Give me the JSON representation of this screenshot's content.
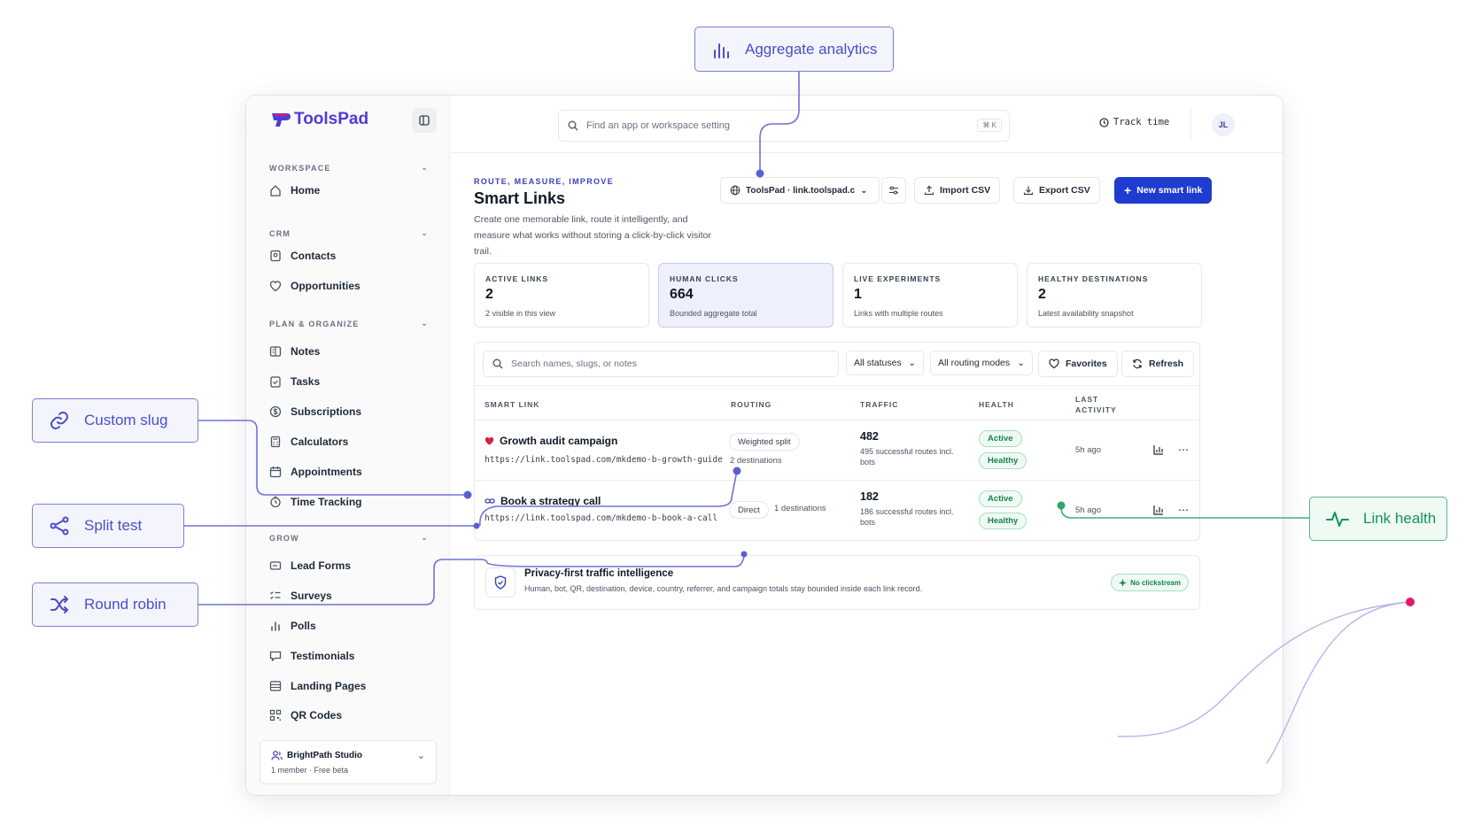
{
  "callouts": {
    "aggregate": "Aggregate analytics",
    "custom_slug": "Custom slug",
    "split_test": "Split test",
    "round_robin": "Round robin",
    "link_health": "Link health"
  },
  "brand": {
    "name": "ToolsPad",
    "accent": "#4f3cd6",
    "primary": "#1f3bd0",
    "healthy_green": "#16935a"
  },
  "sidebar": {
    "sections": [
      {
        "title": "WORKSPACE",
        "items": [
          "Home"
        ]
      },
      {
        "title": "CRM",
        "items": [
          "Contacts",
          "Opportunities"
        ]
      },
      {
        "title": "PLAN & ORGANIZE",
        "items": [
          "Notes",
          "Tasks",
          "Subscriptions",
          "Calculators",
          "Appointments",
          "Time Tracking"
        ]
      },
      {
        "title": "GROW",
        "items": [
          "Lead Forms",
          "Surveys",
          "Polls",
          "Testimonials",
          "Landing Pages",
          "QR Codes"
        ]
      }
    ],
    "workspace": {
      "name": "BrightPath Studio",
      "sub": "1 member · Free beta"
    }
  },
  "topbar": {
    "search_placeholder": "Find an app or workspace setting",
    "shortcut": "⌘ K",
    "track_time": "Track time",
    "avatar_initials": "JL"
  },
  "header": {
    "eyebrow": "ROUTE, MEASURE, IMPROVE",
    "title": "Smart Links",
    "description": "Create one memorable link, route it intelligently, and measure what works without storing a click-by-click visitor trail."
  },
  "actions": {
    "domain_select": "ToolsPad · link.toolspad.c",
    "import": "Import CSV",
    "export": "Export CSV",
    "new": "New smart link"
  },
  "stats": [
    {
      "label": "ACTIVE LINKS",
      "value": "2",
      "note": "2 visible in this view"
    },
    {
      "label": "HUMAN CLICKS",
      "value": "664",
      "note": "Bounded aggregate total"
    },
    {
      "label": "LIVE EXPERIMENTS",
      "value": "1",
      "note": "Links with multiple routes"
    },
    {
      "label": "HEALTHY DESTINATIONS",
      "value": "2",
      "note": "Latest availability snapshot"
    }
  ],
  "filters": {
    "search_placeholder": "Search names, slugs, or notes",
    "status": "All statuses",
    "routing": "All routing modes",
    "favorites": "Favorites",
    "refresh": "Refresh"
  },
  "table": {
    "columns": {
      "link": "SMART LINK",
      "routing": "ROUTING",
      "traffic": "TRAFFIC",
      "health": "HEALTH",
      "last_l1": "LAST",
      "last_l2": "ACTIVITY"
    },
    "rows": [
      {
        "name": "Growth audit campaign",
        "url": "https://link.toolspad.com/mkdemo-b-growth-guide",
        "routing": "Weighted split",
        "destinations": "2 destinations",
        "traffic": "482",
        "traffic_sub": "495 successful routes incl. bots",
        "status": "Active",
        "health": "Healthy",
        "last": "5h ago"
      },
      {
        "name": "Book a strategy call",
        "url": "https://link.toolspad.com/mkdemo-b-book-a-call",
        "routing": "Direct",
        "destinations": "1 destinations",
        "traffic": "182",
        "traffic_sub": "186 successful routes incl. bots",
        "status": "Active",
        "health": "Healthy",
        "last": "5h ago"
      }
    ]
  },
  "privacy": {
    "title": "Privacy-first traffic intelligence",
    "text": "Human, bot, QR, destination, device, country, referrer, and campaign totals stay bounded inside each link record.",
    "badge": "No clickstream"
  }
}
